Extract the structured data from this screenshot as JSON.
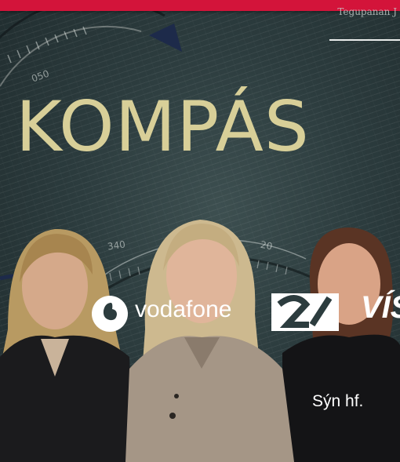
{
  "banner": {
    "headline_fragment": "Tegupanan J",
    "title": "KOMPÁS",
    "dial_labels": [
      "050",
      "340",
      "20"
    ]
  },
  "sponsors": {
    "vodafone": {
      "name": "vodafone",
      "icon": "vodafone-speechmark-icon"
    },
    "stod2": {
      "icon": "stod2-logo-icon"
    },
    "vis": {
      "name": "VÍS"
    }
  },
  "company_name": "Sýn hf.",
  "colors": {
    "top_bar": "#d3143a",
    "title": "#d8cf98",
    "background": "#2c3c3e",
    "text_light": "#ffffff"
  }
}
